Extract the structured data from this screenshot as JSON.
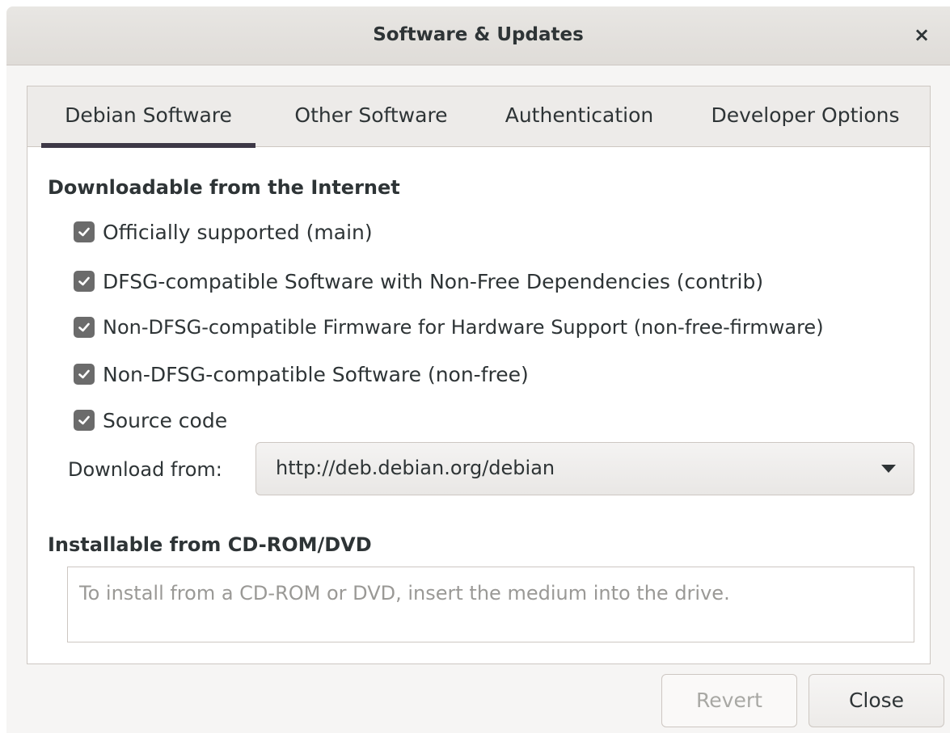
{
  "window": {
    "title": "Software & Updates",
    "close_glyph": "×"
  },
  "tabs": [
    {
      "label": "Debian Software",
      "active": true
    },
    {
      "label": "Other Software",
      "active": false
    },
    {
      "label": "Authentication",
      "active": false
    },
    {
      "label": "Developer Options",
      "active": false
    }
  ],
  "internet": {
    "title": "Downloadable from the Internet",
    "options": [
      {
        "label": "Officially supported (main)",
        "checked": true
      },
      {
        "label": "DFSG-compatible Software with Non-Free Dependencies (contrib)",
        "checked": true
      },
      {
        "label": "Non-DFSG-compatible Firmware for Hardware Support (non-free-firmware)",
        "checked": true
      },
      {
        "label": "Non-DFSG-compatible Software (non-free)",
        "checked": true
      },
      {
        "label": "Source code",
        "checked": true
      }
    ],
    "download_from_label": "Download from:",
    "download_from_value": "http://deb.debian.org/debian"
  },
  "cdrom": {
    "title": "Installable from CD-ROM/DVD",
    "placeholder": "To install from a CD-ROM or DVD, insert the medium into the drive."
  },
  "buttons": {
    "revert": "Revert",
    "close": "Close"
  },
  "icons": {
    "checkbox": "checkmark-icon",
    "dropdown": "chevron-down-icon",
    "window_close": "close-icon"
  },
  "colors": {
    "checkbox_fill": "#6b6b6b",
    "tab_indicator": "#3d3846",
    "disabled_text": "#a8a8a4"
  }
}
